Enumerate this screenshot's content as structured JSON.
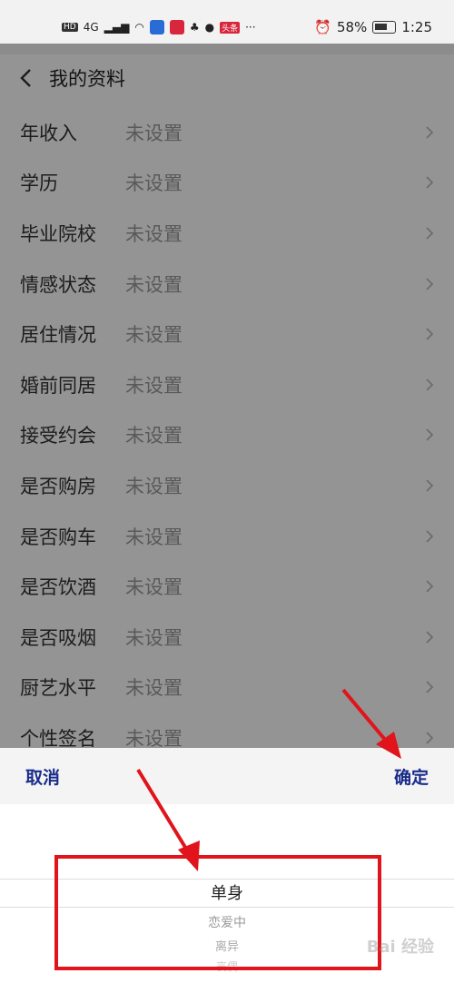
{
  "status_bar": {
    "left_badge": "HD",
    "network": "4G",
    "right_badge": "头条",
    "more": "···",
    "battery": "58%",
    "time": "1:25"
  },
  "header": {
    "title": "我的资料"
  },
  "rows": [
    {
      "label": "年收入",
      "value": "未设置"
    },
    {
      "label": "学历",
      "value": "未设置"
    },
    {
      "label": "毕业院校",
      "value": "未设置"
    },
    {
      "label": "情感状态",
      "value": "未设置"
    },
    {
      "label": "居住情况",
      "value": "未设置"
    },
    {
      "label": "婚前同居",
      "value": "未设置"
    },
    {
      "label": "接受约会",
      "value": "未设置"
    },
    {
      "label": "是否购房",
      "value": "未设置"
    },
    {
      "label": "是否购车",
      "value": "未设置"
    },
    {
      "label": "是否饮酒",
      "value": "未设置"
    },
    {
      "label": "是否吸烟",
      "value": "未设置"
    },
    {
      "label": "厨艺水平",
      "value": "未设置"
    },
    {
      "label": "个性签名",
      "value": "未设置"
    }
  ],
  "picker": {
    "cancel_label": "取消",
    "confirm_label": "确定",
    "options": [
      "单身",
      "恋爱中",
      "离异",
      "丧偶"
    ]
  },
  "watermark": "Bai 经验",
  "colors": {
    "accent": "#1a2c8a",
    "annotation": "#e0141a"
  }
}
